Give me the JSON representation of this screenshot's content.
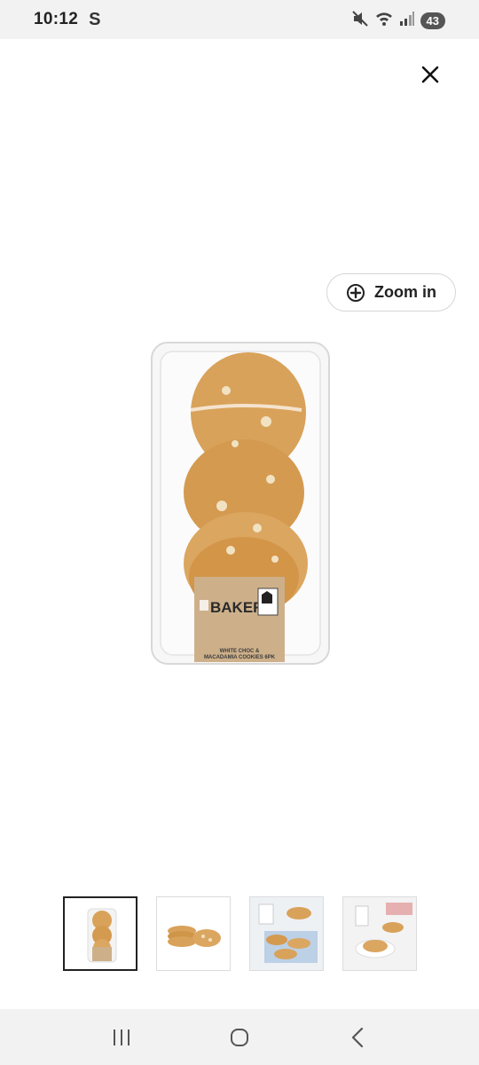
{
  "status_bar": {
    "time": "10:12",
    "carrier_glyph": "S",
    "battery_level": "43",
    "icons": [
      "mute-icon",
      "wifi-icon",
      "signal-icon"
    ]
  },
  "viewer": {
    "close_icon": "close-icon",
    "zoom_label": "Zoom in",
    "zoom_icon": "zoom-plus-icon"
  },
  "product_image": {
    "label_brand": "BAKERY",
    "label_brand_prefix": "coles",
    "label_text_line1": "WHITE CHOC &",
    "label_text_line2": "MACADAMIA COOKIES 6PK"
  },
  "thumbnails": [
    {
      "name": "thumb-package",
      "selected": true
    },
    {
      "name": "thumb-cookies-stack",
      "selected": false
    },
    {
      "name": "thumb-cookies-milk",
      "selected": false
    },
    {
      "name": "thumb-cookie-plate",
      "selected": false
    }
  ],
  "nav_bar": {
    "buttons": [
      "recent-apps-icon",
      "home-icon",
      "back-icon"
    ]
  },
  "colors": {
    "status_bg": "#f2f2f2",
    "label_tan": "#cdb08a",
    "cookie": "#d9a25a"
  }
}
